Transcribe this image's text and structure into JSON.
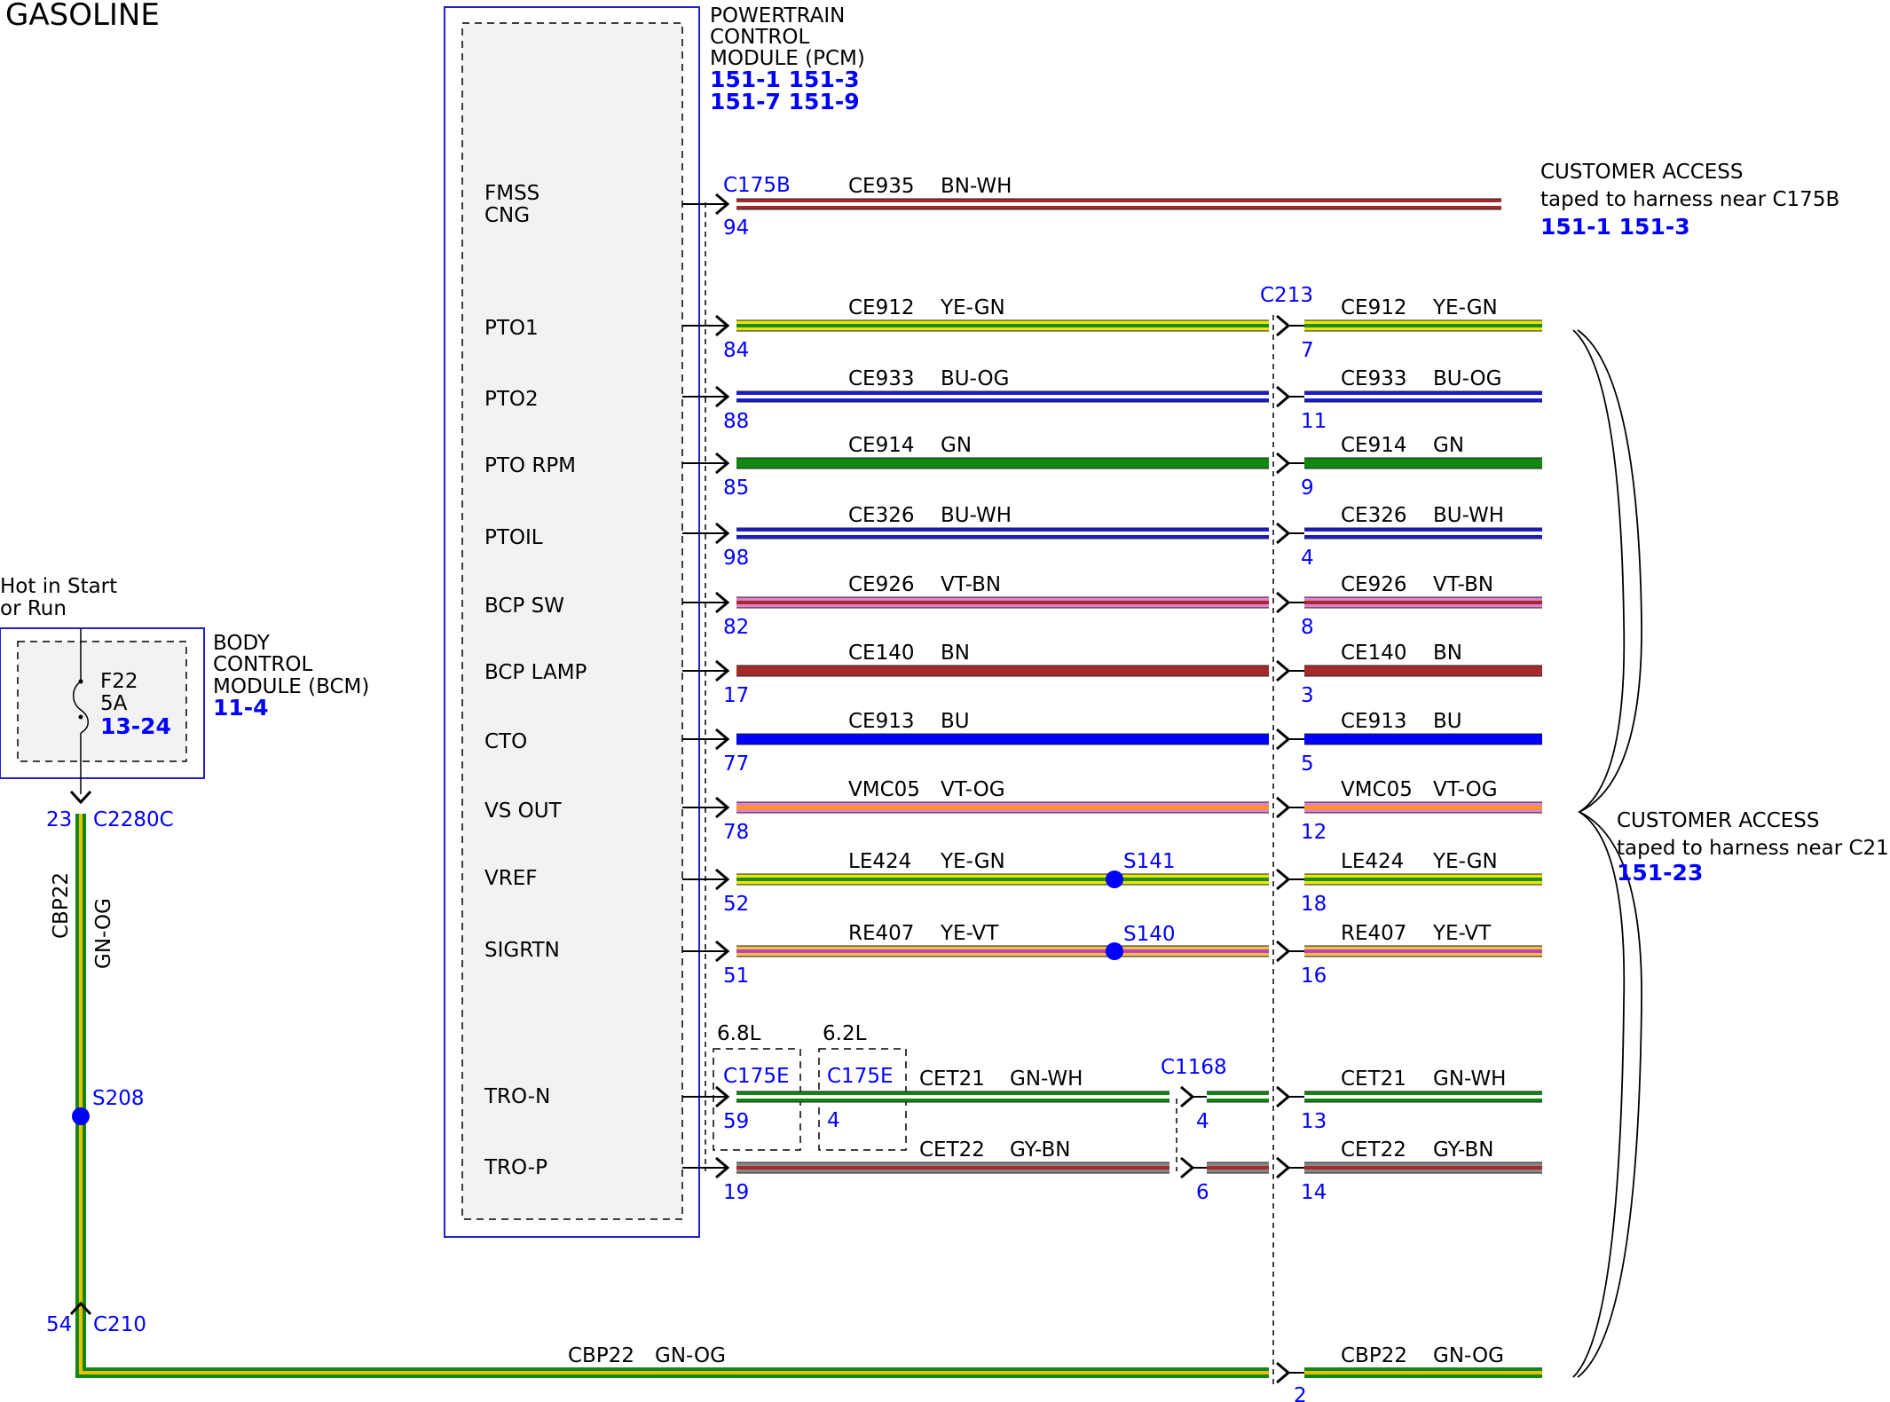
{
  "diagram_title": "GASOLINE",
  "pcm": {
    "name_lines": [
      "POWERTRAIN",
      "CONTROL",
      "MODULE (PCM)"
    ],
    "refs_lines": [
      "151-1 151-3",
      "151-7 151-9"
    ],
    "pins": [
      "FMSS CNG",
      "PTO1",
      "PTO2",
      "PTO RPM",
      "PTOIL",
      "BCP SW",
      "BCP LAMP",
      "CTO",
      "VS OUT",
      "VREF",
      "SIGRTN",
      "TRO-N",
      "TRO-P"
    ],
    "fmss_lines": [
      "FMSS",
      "CNG"
    ]
  },
  "bcm": {
    "hot_lines": [
      "Hot in Start",
      "or Run"
    ],
    "name_lines": [
      "BODY",
      "CONTROL",
      "MODULE (BCM)"
    ],
    "ref": "11-4",
    "fuse": "F22",
    "amps": "5A",
    "fuse_ref": "13-24"
  },
  "connectors": {
    "c175b": "C175B",
    "c213": "C213",
    "c1168": "C1168",
    "c175e_a": "C175E",
    "c175e_b": "C175E",
    "c2280c": "C2280C",
    "c210": "C210",
    "engine_a": "6.8L",
    "engine_b": "6.2L"
  },
  "splices": {
    "s141": "S141",
    "s140": "S140",
    "s208": "S208"
  },
  "customer_access_1": {
    "title": "CUSTOMER ACCESS",
    "note": "taped to harness near C175B",
    "refs": "151-1 151-3"
  },
  "customer_access_2": {
    "title": "CUSTOMER ACCESS",
    "note": "taped to harness near C213",
    "refs": "151-23"
  },
  "wires": [
    {
      "circuit": "CE935",
      "color_code": "BN-WH",
      "pcm_pin": "94",
      "c213_pin": "",
      "base": "#a52a2a",
      "stripe": "#ffffff"
    },
    {
      "circuit": "CE912",
      "color_code": "YE-GN",
      "pcm_pin": "84",
      "c213_pin": "7",
      "base": "#e8e800",
      "stripe": "#228b22"
    },
    {
      "circuit": "CE933",
      "color_code": "BU-OG",
      "pcm_pin": "88",
      "c213_pin": "11",
      "base": "#1a1ad6",
      "stripe": "#ffffff"
    },
    {
      "circuit": "CE914",
      "color_code": "GN",
      "pcm_pin": "85",
      "c213_pin": "9",
      "base": "#118811",
      "stripe": ""
    },
    {
      "circuit": "CE326",
      "color_code": "BU-WH",
      "pcm_pin": "98",
      "c213_pin": "4",
      "base": "#1a1ad6",
      "stripe": "#ffffff"
    },
    {
      "circuit": "CE926",
      "color_code": "VT-BN",
      "pcm_pin": "82",
      "c213_pin": "8",
      "base": "#e37fd0",
      "stripe": "#a52a2a"
    },
    {
      "circuit": "CE140",
      "color_code": "BN",
      "pcm_pin": "17",
      "c213_pin": "3",
      "base": "#a52a2a",
      "stripe": ""
    },
    {
      "circuit": "CE913",
      "color_code": "BU",
      "pcm_pin": "77",
      "c213_pin": "5",
      "base": "#0000ff",
      "stripe": ""
    },
    {
      "circuit": "VMC05",
      "color_code": "VT-OG",
      "pcm_pin": "78",
      "c213_pin": "12",
      "base": "#e37fd0",
      "stripe": "#ff9900"
    },
    {
      "circuit": "LE424",
      "color_code": "YE-GN",
      "pcm_pin": "52",
      "c213_pin": "18",
      "base": "#e8e800",
      "stripe": "#228b22"
    },
    {
      "circuit": "RE407",
      "color_code": "YE-VT",
      "pcm_pin": "51",
      "c213_pin": "16",
      "base": "#f0c040",
      "stripe": "#c040c0"
    },
    {
      "circuit": "CET21",
      "color_code": "GN-WH",
      "pcm_pin": "59",
      "c213_pin": "13",
      "c175e_pin": "4",
      "c1168_pin": "4",
      "base": "#118811",
      "stripe": "#ffffff"
    },
    {
      "circuit": "CET22",
      "color_code": "GY-BN",
      "pcm_pin": "19",
      "c213_pin": "14",
      "c1168_pin": "6",
      "base": "#888888",
      "stripe": "#a52a2a"
    }
  ],
  "bcm_wire": {
    "circuit": "CBP22",
    "color_code": "GN-OG",
    "c2280c_pin": "23",
    "c210_pin": "54",
    "c213_pin": "2",
    "base": "#118811",
    "stripe": "#e8c000"
  }
}
